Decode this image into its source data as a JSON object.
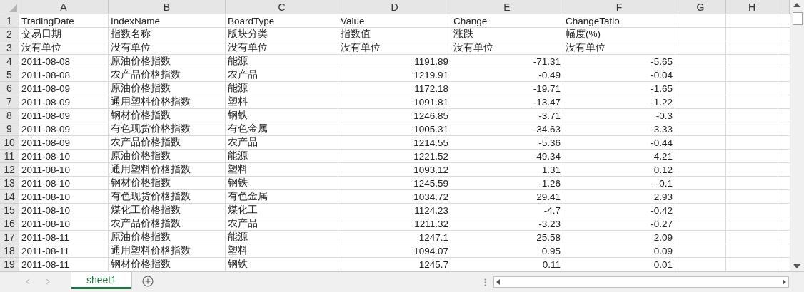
{
  "columns": [
    {
      "letter": "A",
      "kind": "text"
    },
    {
      "letter": "B",
      "kind": "text"
    },
    {
      "letter": "C",
      "kind": "text"
    },
    {
      "letter": "D",
      "kind": "number"
    },
    {
      "letter": "E",
      "kind": "number"
    },
    {
      "letter": "F",
      "kind": "number"
    },
    {
      "letter": "G",
      "kind": "text"
    },
    {
      "letter": "H",
      "kind": "text"
    }
  ],
  "rows": [
    {
      "number": "1",
      "kind": "header",
      "cells": [
        "TradingDate",
        "IndexName",
        "BoardType",
        "Value",
        "Change",
        "ChangeTatio"
      ]
    },
    {
      "number": "2",
      "kind": "header",
      "cells": [
        "交易日期",
        "指数名称",
        "版块分类",
        "指数值",
        "涨跌",
        "幅度(%)"
      ]
    },
    {
      "number": "3",
      "kind": "header",
      "cells": [
        "没有单位",
        "没有单位",
        "没有单位",
        "没有单位",
        "没有单位",
        "没有单位"
      ]
    },
    {
      "number": "4",
      "kind": "data",
      "cells": [
        "2011-08-08",
        "原油价格指数",
        "能源",
        "1191.89",
        "-71.31",
        "-5.65"
      ]
    },
    {
      "number": "5",
      "kind": "data",
      "cells": [
        "2011-08-08",
        "农产品价格指数",
        "农产品",
        "1219.91",
        "-0.49",
        "-0.04"
      ]
    },
    {
      "number": "6",
      "kind": "data",
      "cells": [
        "2011-08-09",
        "原油价格指数",
        "能源",
        "1172.18",
        "-19.71",
        "-1.65"
      ]
    },
    {
      "number": "7",
      "kind": "data",
      "cells": [
        "2011-08-09",
        "通用塑料价格指数",
        "塑料",
        "1091.81",
        "-13.47",
        "-1.22"
      ]
    },
    {
      "number": "8",
      "kind": "data",
      "cells": [
        "2011-08-09",
        "钢材价格指数",
        "钢铁",
        "1246.85",
        "-3.71",
        "-0.3"
      ]
    },
    {
      "number": "9",
      "kind": "data",
      "cells": [
        "2011-08-09",
        "有色现货价格指数",
        "有色金属",
        "1005.31",
        "-34.63",
        "-3.33"
      ]
    },
    {
      "number": "10",
      "kind": "data",
      "cells": [
        "2011-08-09",
        "农产品价格指数",
        "农产品",
        "1214.55",
        "-5.36",
        "-0.44"
      ]
    },
    {
      "number": "11",
      "kind": "data",
      "cells": [
        "2011-08-10",
        "原油价格指数",
        "能源",
        "1221.52",
        "49.34",
        "4.21"
      ]
    },
    {
      "number": "12",
      "kind": "data",
      "cells": [
        "2011-08-10",
        "通用塑料价格指数",
        "塑料",
        "1093.12",
        "1.31",
        "0.12"
      ]
    },
    {
      "number": "13",
      "kind": "data",
      "cells": [
        "2011-08-10",
        "钢材价格指数",
        "钢铁",
        "1245.59",
        "-1.26",
        "-0.1"
      ]
    },
    {
      "number": "14",
      "kind": "data",
      "cells": [
        "2011-08-10",
        "有色现货价格指数",
        "有色金属",
        "1034.72",
        "29.41",
        "2.93"
      ]
    },
    {
      "number": "15",
      "kind": "data",
      "cells": [
        "2011-08-10",
        "煤化工价格指数",
        "煤化工",
        "1124.23",
        "-4.7",
        "-0.42"
      ]
    },
    {
      "number": "16",
      "kind": "data",
      "cells": [
        "2011-08-10",
        "农产品价格指数",
        "农产品",
        "1211.32",
        "-3.23",
        "-0.27"
      ]
    },
    {
      "number": "17",
      "kind": "data",
      "cells": [
        "2011-08-11",
        "原油价格指数",
        "能源",
        "1247.1",
        "25.58",
        "2.09"
      ]
    },
    {
      "number": "18",
      "kind": "data",
      "cells": [
        "2011-08-11",
        "通用塑料价格指数",
        "塑料",
        "1094.07",
        "0.95",
        "0.09"
      ]
    },
    {
      "number": "19",
      "kind": "data",
      "cells": [
        "2011-08-11",
        "钢材价格指数",
        "钢铁",
        "1245.7",
        "0.11",
        "0.01"
      ]
    }
  ],
  "sheet_tabs": [
    {
      "label": "sheet1",
      "selected": true
    }
  ]
}
